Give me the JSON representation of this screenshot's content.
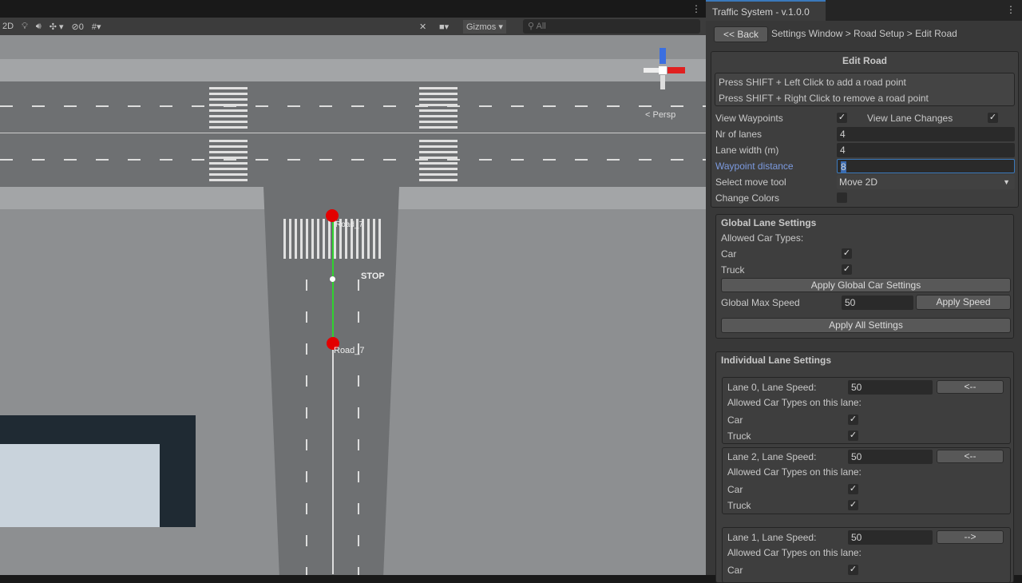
{
  "toolbar": {
    "mode_2d": "2D",
    "hidden_count": "0",
    "gizmos": "Gizmos",
    "search_placeholder": "All"
  },
  "scene": {
    "persp_label": "< Persp",
    "road_labels": [
      "Road_7",
      "Road_7"
    ],
    "stop_text": "STOP"
  },
  "panel": {
    "tab_title": "Traffic System - v.1.0.0",
    "back_label": "<< Back",
    "breadcrumb": "Settings Window > Road Setup > Edit Road",
    "section_title": "Edit Road",
    "hints": [
      "Press SHIFT + Left Click to add a road point",
      "Press SHIFT + Right Click to remove a road point"
    ],
    "view_waypoints": "View Waypoints",
    "view_waypoints_checked": true,
    "view_lane_changes": "View Lane Changes",
    "view_lane_changes_checked": true,
    "nr_lanes_label": "Nr of lanes",
    "nr_lanes": "4",
    "lane_width_label": "Lane width (m)",
    "lane_width": "4",
    "waypoint_distance_label": "Waypoint distance",
    "waypoint_distance": "8",
    "move_tool_label": "Select move tool",
    "move_tool": "Move 2D",
    "change_colors_label": "Change Colors",
    "change_colors_checked": false,
    "global": {
      "title": "Global Lane Settings",
      "allowed": "Allowed Car Types:",
      "car": "Car",
      "truck": "Truck",
      "apply_car": "Apply Global Car Settings",
      "max_speed_label": "Global Max Speed",
      "max_speed": "50",
      "apply_speed": "Apply Speed",
      "apply_all": "Apply All Settings"
    },
    "individual": {
      "title": "Individual Lane Settings",
      "lanes": [
        {
          "label": "Lane 0, Lane Speed:",
          "speed": "50",
          "dir": "<--",
          "allowed": "Allowed Car Types on this lane:",
          "car": "Car",
          "truck": "Truck"
        },
        {
          "label": "Lane 2, Lane Speed:",
          "speed": "50",
          "dir": "<--",
          "allowed": "Allowed Car Types on this lane:",
          "car": "Car",
          "truck": "Truck"
        },
        {
          "label": "Lane 1, Lane Speed:",
          "speed": "50",
          "dir": "-->",
          "allowed": "Allowed Car Types on this lane:",
          "car": "Car"
        }
      ]
    }
  }
}
